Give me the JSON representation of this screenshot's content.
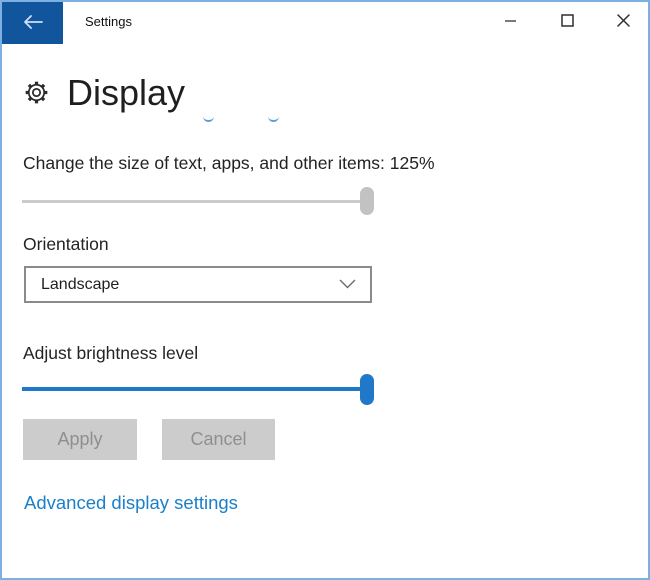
{
  "titlebar": {
    "title": "Settings",
    "back_icon": "back-arrow-icon",
    "minimize_icon": "minimize-icon",
    "maximize_icon": "maximize-icon",
    "close_icon": "close-icon"
  },
  "header": {
    "icon": "gear-icon",
    "title": "Display"
  },
  "scaling": {
    "label": "Change the size of text, apps, and other items: 125%",
    "percent": "125%",
    "thumb_position_pct": 100
  },
  "orientation": {
    "label": "Orientation",
    "selected": "Landscape",
    "chevron_icon": "chevron-down-icon"
  },
  "brightness": {
    "label": "Adjust brightness level",
    "thumb_position_pct": 100
  },
  "actions": {
    "apply": "Apply",
    "cancel": "Cancel"
  },
  "links": {
    "advanced_display_settings": "Advanced display settings"
  },
  "colors": {
    "accent": "#11569d",
    "slider_blue": "#1f79c8",
    "link_blue": "#1b80c9",
    "window_border": "#7db0e0",
    "disabled_button_bg": "#cccccc",
    "disabled_button_text": "#8f8f8f"
  }
}
